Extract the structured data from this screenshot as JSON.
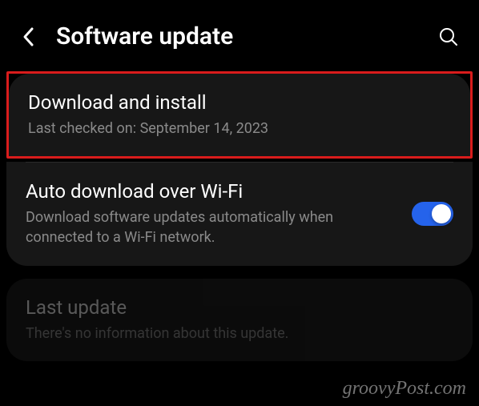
{
  "header": {
    "title": "Software update"
  },
  "items": {
    "download": {
      "title": "Download and install",
      "subtitle": "Last checked on: September 14, 2023"
    },
    "autoDownload": {
      "title": "Auto download over Wi-Fi",
      "subtitle": "Download software updates automatically when connected to a Wi-Fi network.",
      "toggleOn": true
    },
    "lastUpdate": {
      "title": "Last update",
      "subtitle": "There's no information about this update."
    }
  },
  "watermark": "groovyPost.com"
}
